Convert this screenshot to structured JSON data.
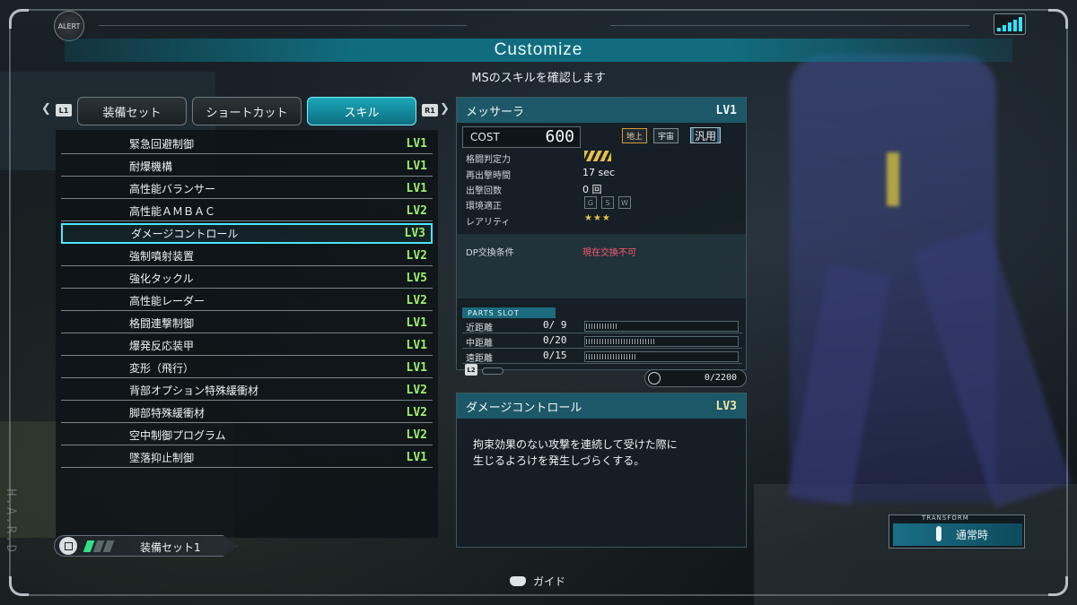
{
  "hud": {
    "alert": "ALERT",
    "side_text": "H.A.R.D"
  },
  "header": {
    "title": "Customize",
    "subtitle": "MSのスキルを確認します"
  },
  "tabs": {
    "left_hint": "L1",
    "right_hint": "R1",
    "items": [
      {
        "label": "装備セット"
      },
      {
        "label": "ショートカット"
      },
      {
        "label": "スキル"
      }
    ],
    "active_index": 2
  },
  "skills": [
    {
      "name": "緊急回避制御",
      "level": "LV1"
    },
    {
      "name": "耐爆機構",
      "level": "LV1"
    },
    {
      "name": "高性能バランサー",
      "level": "LV1"
    },
    {
      "name": "高性能ＡＭＢＡＣ",
      "level": "LV2"
    },
    {
      "name": "ダメージコントロール",
      "level": "LV3"
    },
    {
      "name": "強制噴射装置",
      "level": "LV2"
    },
    {
      "name": "強化タックル",
      "level": "LV5"
    },
    {
      "name": "高性能レーダー",
      "level": "LV2"
    },
    {
      "name": "格闘連撃制御",
      "level": "LV1"
    },
    {
      "name": "爆発反応装甲",
      "level": "LV1"
    },
    {
      "name": "変形（飛行）",
      "level": "LV1"
    },
    {
      "name": "背部オプション特殊緩衝材",
      "level": "LV2"
    },
    {
      "name": "脚部特殊緩衝材",
      "level": "LV2"
    },
    {
      "name": "空中制御プログラム",
      "level": "LV2"
    },
    {
      "name": "墜落抑止制御",
      "level": "LV1"
    }
  ],
  "selected_skill_index": 4,
  "status": {
    "loadout_label": "装備セット1"
  },
  "ms": {
    "name": "メッサーラ",
    "level": "LV1",
    "cost_label": "COST",
    "cost": "600",
    "env_tags": [
      "地上",
      "宇宙",
      "汎用"
    ],
    "stats": [
      {
        "key": "格闘判定力",
        "value": ""
      },
      {
        "key": "再出撃時間",
        "value": "17 sec"
      },
      {
        "key": "出撃回数",
        "value": "0 回"
      },
      {
        "key": "環境適正",
        "value": ""
      },
      {
        "key": "レアリティ",
        "value": "★★★"
      }
    ],
    "env_grades": [
      "G",
      "S",
      "W"
    ],
    "dp_label": "DP交換条件",
    "dp_value": "現在交換不可",
    "parts_slot_title": "PARTS SLOT",
    "parts_slots": [
      {
        "key": "近距離",
        "value": "0/ 9",
        "fraction": 0.2
      },
      {
        "key": "中距離",
        "value": "0/20",
        "fraction": 0.45
      },
      {
        "key": "遠距離",
        "value": "0/15",
        "fraction": 0.33
      }
    ],
    "l2_hint": "L2",
    "capacity": "0/2200"
  },
  "skill_detail": {
    "name": "ダメージコントロール",
    "level": "LV3",
    "description_line1": "拘束効果のない攻撃を連続して受けた際に",
    "description_line2": "生じるよろけを発生しづらくする。"
  },
  "transform": {
    "label": "TRANSFORM",
    "value": "通常時"
  },
  "guide": {
    "label": "ガイド"
  },
  "colors": {
    "accent": "#1aa7b9",
    "level_green": "#9cf06a",
    "dp_red": "#ff5b6e"
  }
}
